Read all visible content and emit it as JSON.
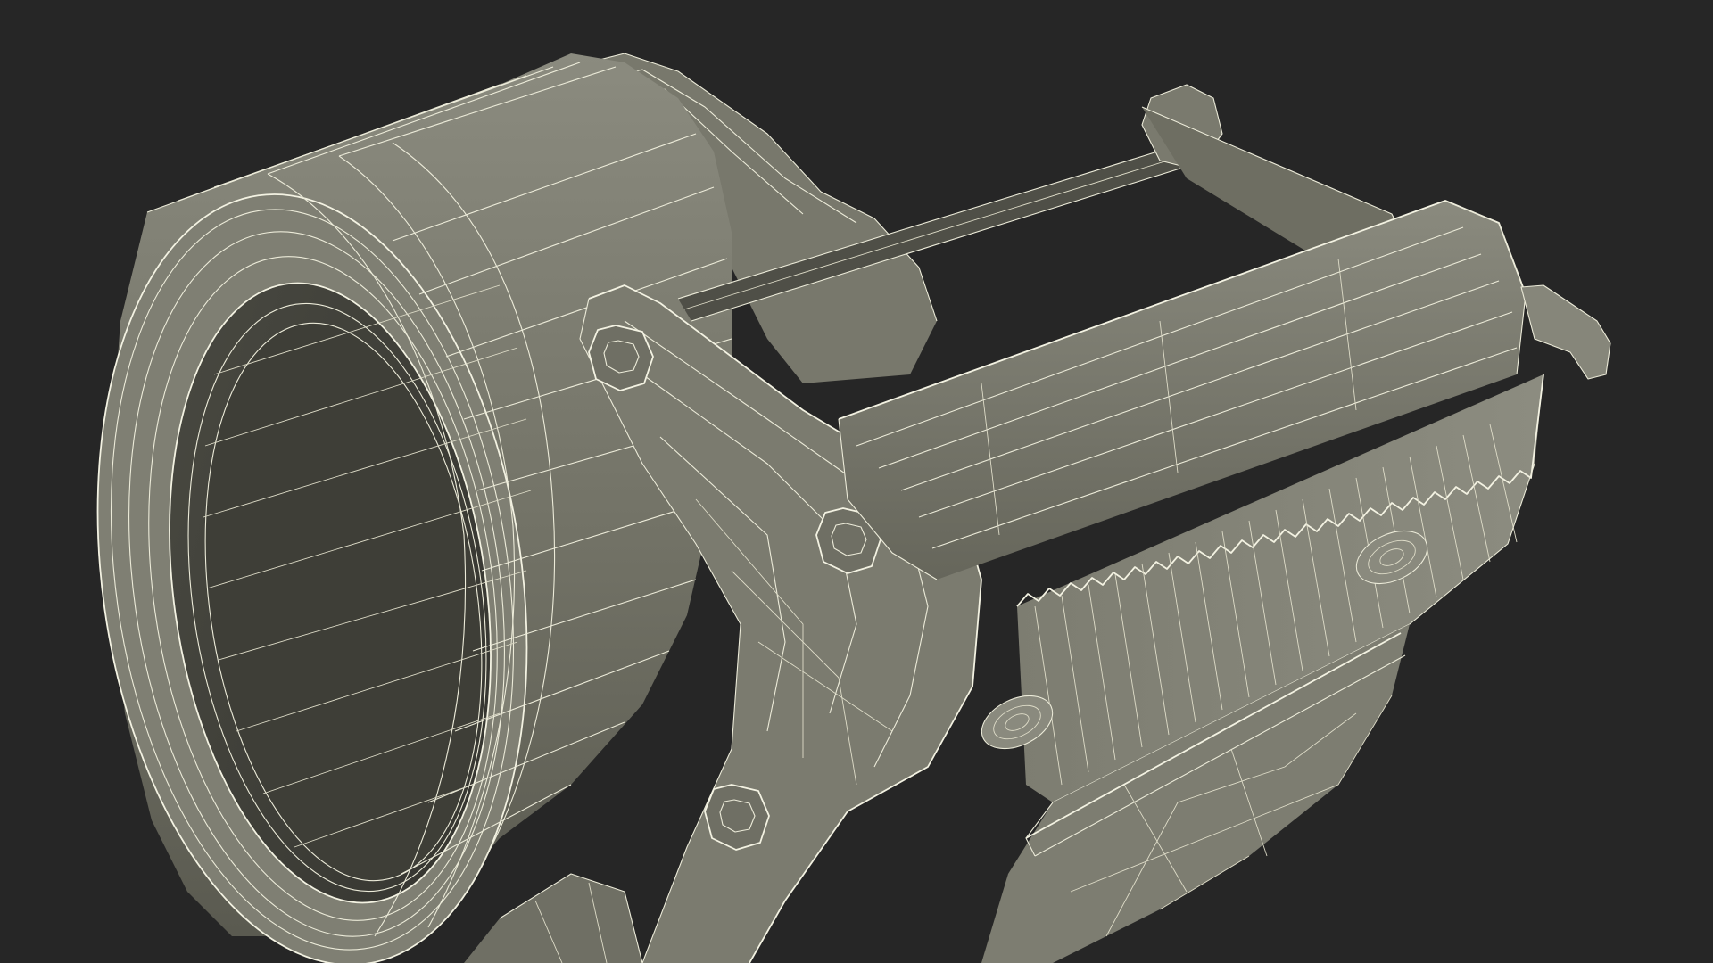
{
  "scene": {
    "background": "#262626",
    "subject": "tape-dispenser-wireframe",
    "colors": {
      "surface_light": "#86867a",
      "surface_mid": "#727266",
      "surface_dark": "#4b4b42",
      "surface_deep": "#3b3b34",
      "wire": "#ecebd9"
    }
  }
}
